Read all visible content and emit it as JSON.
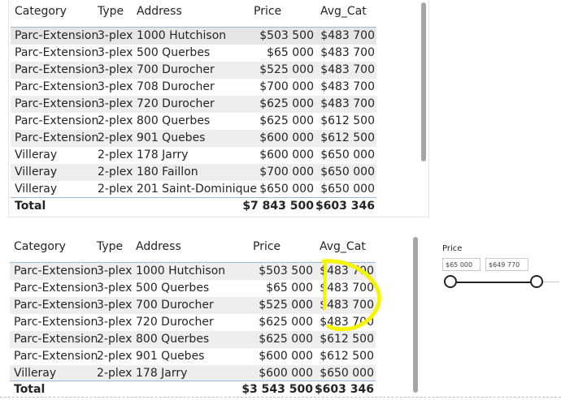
{
  "columns": [
    "Category",
    "Type",
    "Address",
    "Price",
    "Avg_Cat"
  ],
  "table_top": {
    "rows": [
      [
        "Parc-Extension",
        "3-plex",
        "1000 Hutchison",
        "$503 500",
        "$483 700"
      ],
      [
        "Parc-Extension",
        "3-plex",
        "500 Querbes",
        "$65 000",
        "$483 700"
      ],
      [
        "Parc-Extension",
        "3-plex",
        "700 Durocher",
        "$525 000",
        "$483 700"
      ],
      [
        "Parc-Extension",
        "3-plex",
        "708 Durocher",
        "$700 000",
        "$483 700"
      ],
      [
        "Parc-Extension",
        "3-plex",
        "720 Durocher",
        "$625 000",
        "$483 700"
      ],
      [
        "Parc-Extension",
        "2-plex",
        "800 Querbes",
        "$625 000",
        "$612 500"
      ],
      [
        "Parc-Extension",
        "2-plex",
        "901 Quebes",
        "$600 000",
        "$612 500"
      ],
      [
        "Villeray",
        "2-plex",
        "178 Jarry",
        "$600 000",
        "$650 000"
      ],
      [
        "Villeray",
        "2-plex",
        "180 Faillon",
        "$700 000",
        "$650 000"
      ],
      [
        "Villeray",
        "2-plex",
        "201 Saint-Dominique",
        "$650 000",
        "$650 000"
      ]
    ],
    "total": {
      "label": "Total",
      "price": "$7 843 500",
      "avg": "$603 346"
    }
  },
  "table_bottom": {
    "rows": [
      [
        "Parc-Extension",
        "3-plex",
        "1000 Hutchison",
        "$503 500",
        "$483 700"
      ],
      [
        "Parc-Extension",
        "3-plex",
        "500 Querbes",
        "$65 000",
        "$483 700"
      ],
      [
        "Parc-Extension",
        "3-plex",
        "700 Durocher",
        "$525 000",
        "$483 700"
      ],
      [
        "Parc-Extension",
        "3-plex",
        "720 Durocher",
        "$625 000",
        "$483 700"
      ],
      [
        "Parc-Extension",
        "2-plex",
        "800 Querbes",
        "$625 000",
        "$612 500"
      ],
      [
        "Parc-Extension",
        "2-plex",
        "901 Quebes",
        "$600 000",
        "$612 500"
      ],
      [
        "Villeray",
        "2-plex",
        "178 Jarry",
        "$600 000",
        "$650 000"
      ]
    ],
    "total": {
      "label": "Total",
      "price": "$3 543 500",
      "avg": "$603 346"
    }
  },
  "slicer": {
    "title": "Price",
    "min_value": "$65 000",
    "max_value": "$649 770"
  },
  "colors": {
    "annotation": "#f5f500",
    "row_alt": "#eeeeee",
    "header_rule": "#9bb9d9"
  }
}
